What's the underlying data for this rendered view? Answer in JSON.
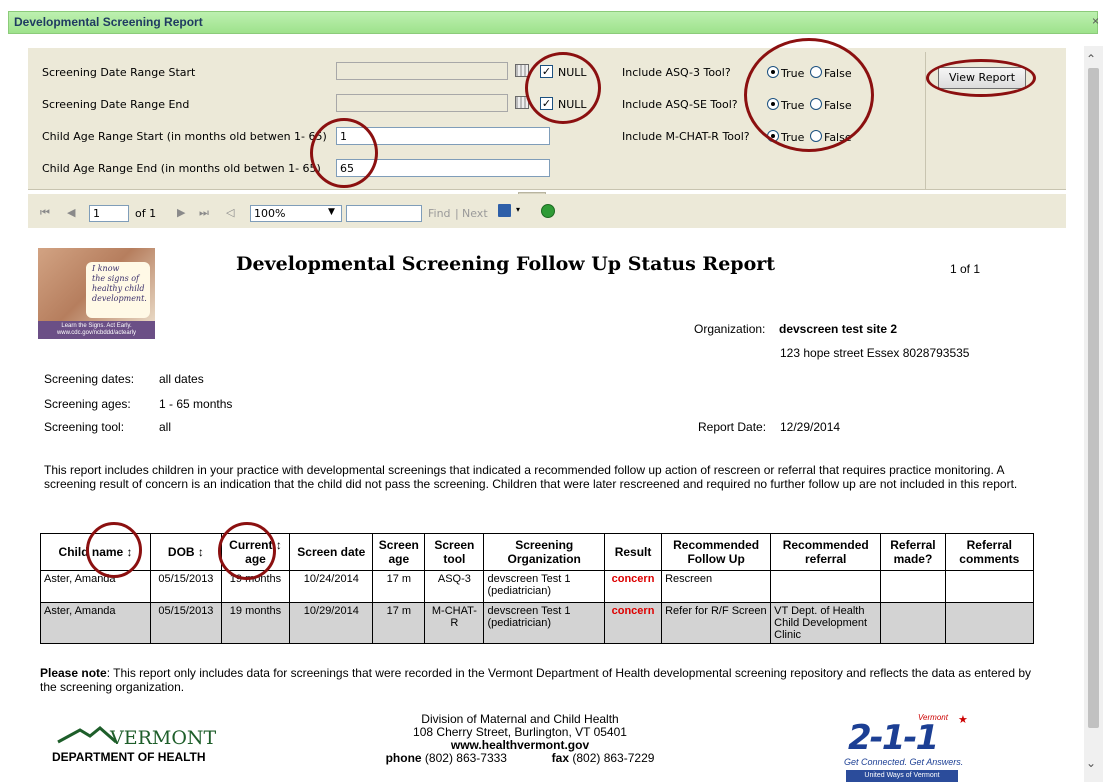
{
  "window": {
    "title": "Developmental Screening Report",
    "close_glyph": "×"
  },
  "params": {
    "start_label": "Screening Date Range Start",
    "end_label": "Screening Date Range End",
    "age_start_label": "Child Age Range Start (in months old betwen 1- 65)",
    "age_end_label": "Child Age Range End (in months old betwen 1- 65)",
    "age_start_value": "1",
    "age_end_value": "65",
    "null_label": "NULL",
    "asq3_label": "Include ASQ-3 Tool?",
    "asqse_label": "Include ASQ-SE Tool?",
    "mchat_label": "Include M-CHAT-R Tool?",
    "true_label": "True",
    "false_label": "False",
    "view_report": "View Report"
  },
  "toolbar": {
    "first": "⏮",
    "prev": "◀",
    "page": "1",
    "of": "of 1",
    "next": "▶",
    "last": "⏭",
    "back": "◁",
    "zoom": "100%",
    "find": "Find",
    "sep": "|",
    "next_label": "Next"
  },
  "report": {
    "logo_text": "I know\nthe signs of\nhealthy child\ndevelopment.",
    "logo_foot": "Learn the Signs. Act Early.\nwww.cdc.gov/ncbddd/actearly",
    "title": "Developmental Screening Follow Up Status Report",
    "page": "1 of 1",
    "org_label": "Organization:",
    "org_name": "devscreen test site 2",
    "org_address": "123 hope street  Essex 8028793535",
    "dates_label": "Screening dates:",
    "dates_value": "all dates",
    "ages_label": "Screening ages:",
    "ages_value": "1 - 65 months",
    "tool_label": "Screening tool:",
    "tool_value": "all",
    "report_date_label": "Report Date:",
    "report_date": "12/29/2014",
    "intro": "This report includes children in your practice with developmental screenings that indicated a recommended follow up action of rescreen or referral that requires practice monitoring. A screening result of concern is an indication that the child did not pass the screening. Children that were later rescreened and required no further follow up are not included in this report.",
    "columns": [
      "Child name ↕",
      "DOB ↕",
      "Current ↕ age",
      "Screen date",
      "Screen age",
      "Screen tool",
      "Screening Organization",
      "Result",
      "Recommended Follow Up",
      "Recommended referral",
      "Referral made?",
      "Referral comments"
    ],
    "rows": [
      [
        "Aster, Amanda",
        "05/15/2013",
        "19 months",
        "10/24/2014",
        "17 m",
        "ASQ-3",
        "devscreen Test 1 (pediatrician)",
        "concern",
        "Rescreen",
        "",
        "",
        ""
      ],
      [
        "Aster, Amanda",
        "05/15/2013",
        "19 months",
        "10/29/2014",
        "17 m",
        "M-CHAT-R",
        "devscreen Test 1 (pediatrician)",
        "concern",
        "Refer for R/F Screen",
        "VT Dept. of Health Child Development Clinic",
        "",
        ""
      ]
    ],
    "note_bold": "Please note",
    "note": ": This report only includes data for screenings that were recorded in the Vermont Department of Health developmental screening repository and reflects the data as entered by the screening organization.",
    "vt_name": "VERMONT",
    "vt_dept": "DEPARTMENT OF HEALTH",
    "footer_line1": "Division of Maternal and Child Health",
    "footer_line2": "108 Cherry Street, Burlington, VT 05401",
    "footer_web": "www.healthvermont.gov",
    "phone_label": "phone",
    "phone": "(802) 863-7333",
    "fax_label": "fax",
    "fax": "(802) 863-7229",
    "l211_vt": "Vermont",
    "l211_num": "2-1-1",
    "l211_tag": "Get Connected. Get Answers.",
    "l211_uw": "United Ways of Vermont"
  },
  "colors": {
    "ring": "#8b1010",
    "title_strip": "#a6e596",
    "panel": "#ece9d8",
    "concern": "#dd0000"
  }
}
